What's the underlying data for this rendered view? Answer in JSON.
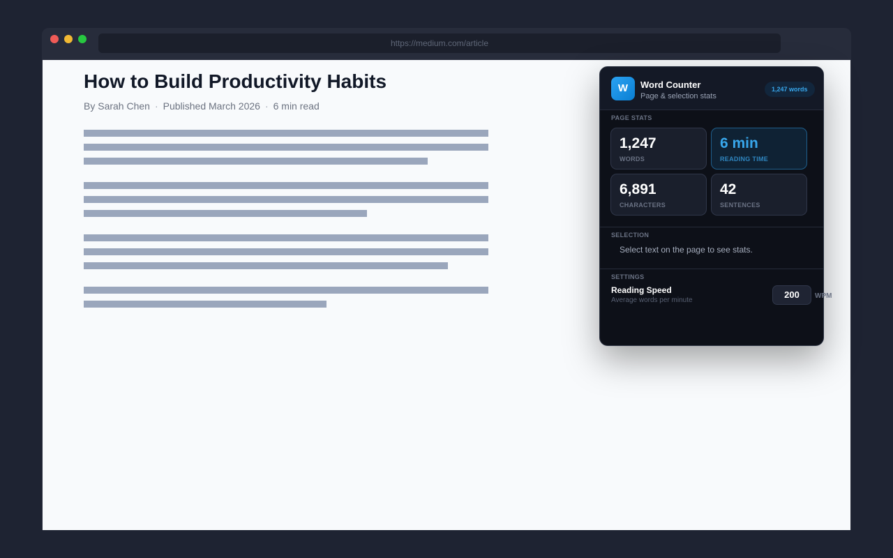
{
  "browser": {
    "url": "https://medium.com/article"
  },
  "article": {
    "title": "How to Build Productivity Habits",
    "author": "By Sarah Chen",
    "published": "Published March 2026",
    "read_time": "6 min read",
    "separator": "·"
  },
  "extension": {
    "icon_letter": "W",
    "name": "Word Counter",
    "subtitle": "Page & selection stats",
    "badge": "1,247 words",
    "page_stats_label": "PAGE STATS",
    "stats": [
      {
        "value": "1,247",
        "label": "WORDS"
      },
      {
        "value": "6 min",
        "label": "READING TIME"
      },
      {
        "value": "6,891",
        "label": "CHARACTERS"
      },
      {
        "value": "42",
        "label": "SENTENCES"
      }
    ],
    "selection_label": "SELECTION",
    "selection_hint": "Select text on the page to see stats.",
    "settings_label": "SETTINGS",
    "reading_speed_title": "Reading Speed",
    "reading_speed_sub": "Average words per minute",
    "reading_speed_value": "200",
    "reading_speed_unit": "WPM",
    "accent_color": "#38a7ec"
  }
}
